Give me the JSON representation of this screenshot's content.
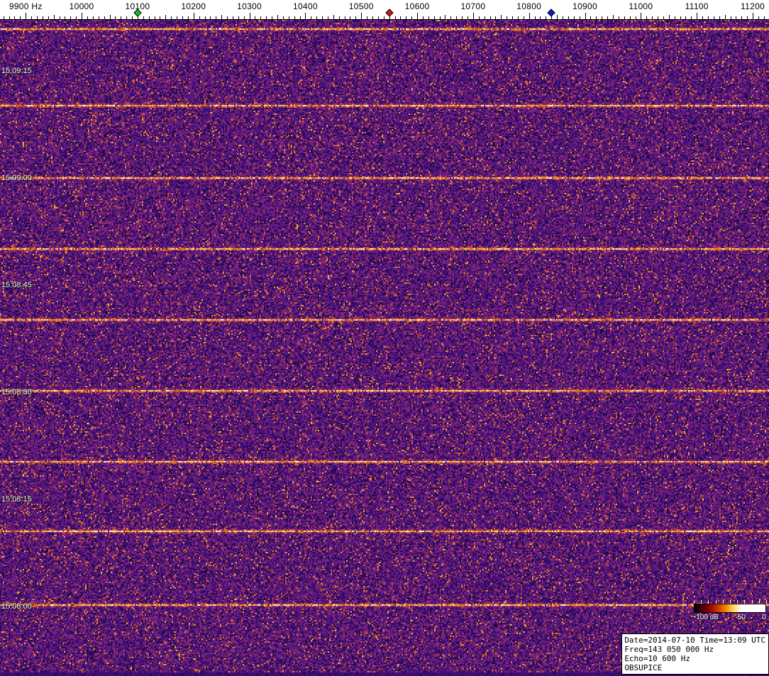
{
  "chart_data": {
    "type": "heatmap",
    "subtype": "waterfall_spectrogram",
    "title": "Radio meteor echo waterfall display",
    "x_axis": {
      "unit": "Hz",
      "tick_start": 9900,
      "tick_step": 100,
      "tick_labels": [
        "9900 Hz",
        "10000",
        "10100",
        "10200",
        "10300",
        "10400",
        "10500",
        "10600",
        "10700",
        "10800",
        "10900",
        "11000",
        "11100",
        "11200"
      ],
      "minor_tick_step_hz": 10,
      "visible_range_hz": [
        9855,
        11230
      ]
    },
    "y_axis": {
      "unit": "time UTC",
      "direction": "newest at top",
      "tick_labels": [
        "15:09:15",
        "15:09:00",
        "15:08:45",
        "15:08:30",
        "15:08:15",
        "15:08:00"
      ],
      "tick_interval_seconds": 15
    },
    "markers": [
      {
        "name": "green-diamond",
        "freq_hz": 10100,
        "color": "#17c317"
      },
      {
        "name": "red-diamond",
        "freq_hz": 10550,
        "color": "#d41515"
      },
      {
        "name": "blue-diamond",
        "freq_hz": 10840,
        "color": "#1515cc"
      }
    ],
    "signal_lines": {
      "description": "bright broadband horizontal lines spanning the full frequency range, repeating about every 10 seconds",
      "y_fractions": [
        0.013,
        0.13,
        0.24,
        0.348,
        0.456,
        0.564,
        0.672,
        0.778,
        0.889
      ]
    },
    "noise_floor": "violet/purple noise speckled with orange flecks",
    "colorbar": {
      "labels": [
        "-100 dB",
        "-50",
        "0"
      ],
      "range_db": [
        -100,
        0
      ]
    },
    "annotation_box": {
      "lines": [
        "Date=2014-07-10 Time=13:09 UTC",
        "Freq=143 050 000 Hz",
        "Echo=10 600 Hz",
        "OBSUPICE"
      ]
    }
  },
  "colors": {
    "axis_background": "#ffffff",
    "noise_purple": "#58188a",
    "signal_line": "#fff8d0"
  }
}
